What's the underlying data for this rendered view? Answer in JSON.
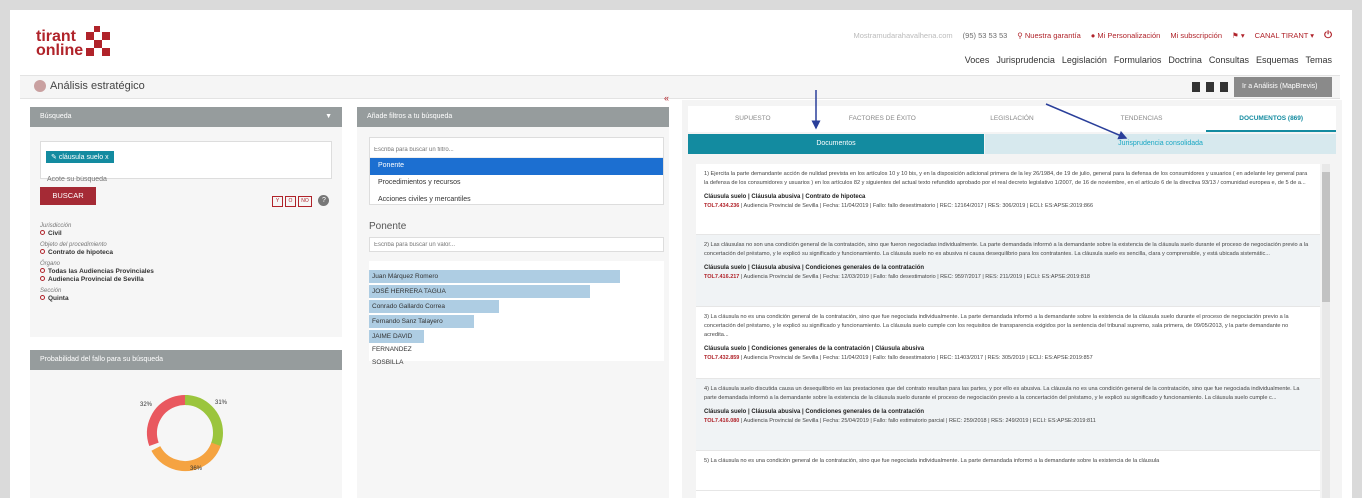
{
  "brand": {
    "line1": "tirant",
    "line2": "online"
  },
  "toplinks": {
    "email": "Mostramudarahavalhena.com",
    "phone": "(95) 53 53 53",
    "guarantee": "Nuestra garantía",
    "personal": "Mi Personalización",
    "subscription": "Mi subscripción",
    "channel": "CANAL TIRANT"
  },
  "mainnav": [
    "Voces",
    "Jurisprudencia",
    "Legislación",
    "Formularios",
    "Doctrina",
    "Consultas",
    "Esquemas",
    "Temas"
  ],
  "subheader": {
    "title": "Análisis estratégico",
    "button": "Ir a Análisis (MapBrevis)"
  },
  "search": {
    "header": "Búsqueda",
    "tag": "cláusula suelo",
    "tag_close": "x",
    "placeholder": "Acote su búsqueda",
    "button": "BUSCAR",
    "opts": [
      "Y",
      "O",
      "NO"
    ],
    "help": "?"
  },
  "facets": [
    {
      "label": "Jurisdicción",
      "values": [
        "Civil"
      ]
    },
    {
      "label": "Objeto del procedimiento",
      "values": [
        "Contrato de hipoteca"
      ]
    },
    {
      "label": "Órgano",
      "values": [
        "Todas las Audiencias Provinciales",
        "Audiencia Provincial de Sevilla"
      ]
    },
    {
      "label": "Sección",
      "values": [
        "Quinta"
      ]
    }
  ],
  "prob": {
    "header": "Probabilidad del fallo para su búsqueda",
    "pct1": "32%",
    "pct2": "31%",
    "pct3": "36%"
  },
  "filters": {
    "header": "Añade filtros a tu búsqueda",
    "placeholder": "Escriba para buscar un filtro...",
    "items": [
      "Ponente",
      "Procedimientos y recursos",
      "Acciones civiles y mercantiles"
    ],
    "ponente_title": "Ponente",
    "ponente_placeholder": "Escriba para buscar un valor...",
    "ponentes": [
      {
        "name": "Juan Márquez Romero",
        "pct": 100
      },
      {
        "name": "JOSÉ HERRERA TAGUA",
        "pct": 88
      },
      {
        "name": "Conrado Gallardo Correa",
        "pct": 52
      },
      {
        "name": "Fernando Sanz Talayero",
        "pct": 42
      },
      {
        "name": "JAIME DAVID FERNANDEZ SOSBILLA",
        "pct": 22
      }
    ]
  },
  "tabs": [
    "SUPUESTO",
    "FACTORES DE ÉXITO",
    "LEGISLACIÓN",
    "TENDENCIAS",
    "DOCUMENTOS (869)"
  ],
  "subtabs": [
    "Documentos",
    "Jurisprudencia consolidada"
  ],
  "docs": [
    {
      "text": "1) Ejercita la parte demandante acción de nulidad prevista en los artículos 10 y 10 bis, y en la disposición adicional primera de la ley 26/1984, de 19 de julio, general para la defensa de los consumidores y usuarios ( en adelante ley general para la defensa de los consumidores y usuarios ) en los artículos 82 y siguientes del actual texto refundido aprobado por el real decreto legislativo 1/2007, de 16 de noviembre, en el artículo 6 de la directiva 93/13 / comunidad europea e, de 5 de a...",
      "title": "Cláusula suelo | Cláusula abusiva | Contrato de hipoteca",
      "ref": "TOL7.434.236",
      "ref_rest": "| Audiencia Provincial de Sevilla | Fecha: 11/04/2019 | Fallo: fallo desestimatorio | REC: 12164/2017 | RES: 306/2019 | ECLI: ES:APSE:2019:866"
    },
    {
      "text": "2) Las cláusulas no son una condición general de la contratación, sino que fueron negociadas individualmente. La parte demandada informó a la demandante sobre la existencia de la cláusula suelo durante el proceso de negociación previo a la concertación del préstamo, y le explicó su significado y funcionamiento. La cláusula suelo no es abusiva ni causa desequilibrio para los contratantes. La cláusula suelo es sencilla, clara y comprensible, y está ubicada sistemátic...",
      "title": "Cláusula suelo | Cláusula abusiva | Condiciones generales de la contratación",
      "ref": "TOL7.416.217",
      "ref_rest": "| Audiencia Provincial de Sevilla | Fecha: 12/03/2019 | Fallo: fallo desestimatorio | REC: 9597/2017 | RES: 211/2019 | ECLI: ES:APSE:2019:818"
    },
    {
      "text": "3) La cláusula no es una condición general de la contratación, sino que fue negociada individualmente. La parte demandada informó a la demandante sobre la existencia de la cláusula suelo durante el proceso de negociación previo a la concertación del préstamo, y le explicó su significado y funcionamiento. La cláusula suelo cumple con los requisitos de transparencia exigidos por la sentencia del tribunal supremo, sala primera, de 09/05/2013, y la parte demandante no acredita...",
      "title": "Cláusula suelo | Condiciones generales de la contratación | Cláusula abusiva",
      "ref": "TOL7.432.859",
      "ref_rest": "| Audiencia Provincial de Sevilla | Fecha: 11/04/2019 | Fallo: fallo desestimatorio | REC: 11403/2017 | RES: 305/2019 | ECLI: ES:APSE:2019:857"
    },
    {
      "text": "4) La cláusula suelo discutida causa un desequilibrio en las prestaciones que del contrato resultan para las partes, y por ello es abusiva. La cláusula no es una condición general de la contratación, sino que fue negociada individualmente. La parte demandada informó a la demandante sobre la existencia de la cláusula suelo durante el proceso de negociación previo a la concertación del préstamo, y le explicó su significado y funcionamiento. La cláusula suelo cumple c...",
      "title": "Cláusula suelo | Cláusula abusiva | Condiciones generales de la contratación",
      "ref": "TOL7.416.080",
      "ref_rest": "| Audiencia Provincial de Sevilla | Fecha: 25/04/2019 | Fallo: fallo estimatorio parcial | REC: 259/2018 | RES: 249/2019 | ECLI: ES:APSE:2019:811"
    },
    {
      "text": "5) La cláusula no es una condición general de la contratación, sino que fue negociada individualmente. La parte demandada informó a la demandante sobre la existencia de la cláusula",
      "title": "",
      "ref": "",
      "ref_rest": ""
    }
  ]
}
